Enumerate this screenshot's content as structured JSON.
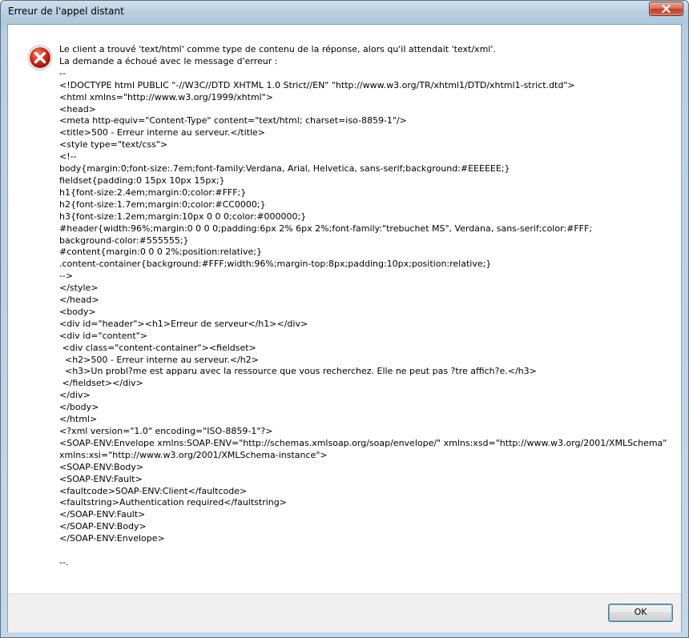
{
  "window": {
    "title": "Erreur de l'appel distant"
  },
  "icons": {
    "error": "error-icon",
    "close": "close-icon"
  },
  "message": {
    "text": "Le client a trouvé 'text/html' comme type de contenu de la réponse, alors qu'il attendait 'text/xml'.\nLa demande a échoué avec le message d'erreur :\n--\n<!DOCTYPE html PUBLIC \"-//W3C//DTD XHTML 1.0 Strict//EN\" \"http://www.w3.org/TR/xhtml1/DTD/xhtml1-strict.dtd\">\n<html xmlns=\"http://www.w3.org/1999/xhtml\">\n<head>\n<meta http-equiv=\"Content-Type\" content=\"text/html; charset=iso-8859-1\"/>\n<title>500 - Erreur interne au serveur.</title>\n<style type=\"text/css\">\n<!--\nbody{margin:0;font-size:.7em;font-family:Verdana, Arial, Helvetica, sans-serif;background:#EEEEEE;}\nfieldset{padding:0 15px 10px 15px;}\nh1{font-size:2.4em;margin:0;color:#FFF;}\nh2{font-size:1.7em;margin:0;color:#CC0000;}\nh3{font-size:1.2em;margin:10px 0 0 0;color:#000000;}\n#header{width:96%;margin:0 0 0 0;padding:6px 2% 6px 2%;font-family:\"trebuchet MS\", Verdana, sans-serif;color:#FFF;\nbackground-color:#555555;}\n#content{margin:0 0 0 2%;position:relative;}\n.content-container{background:#FFF;width:96%;margin-top:8px;padding:10px;position:relative;}\n-->\n</style>\n</head>\n<body>\n<div id=\"header\"><h1>Erreur de serveur</h1></div>\n<div id=\"content\">\n <div class=\"content-container\"><fieldset>\n  <h2>500 - Erreur interne au serveur.</h2>\n  <h3>Un probl?me est apparu avec la ressource que vous recherchez. Elle ne peut pas ?tre affich?e.</h3>\n </fieldset></div>\n</div>\n</body>\n</html>\n<?xml version=\"1.0\" encoding=\"ISO-8859-1\"?>\n<SOAP-ENV:Envelope xmlns:SOAP-ENV=\"http://schemas.xmlsoap.org/soap/envelope/\" xmlns:xsd=\"http://www.w3.org/2001/XMLSchema\"\nxmlns:xsi=\"http://www.w3.org/2001/XMLSchema-instance\">\n<SOAP-ENV:Body>\n<SOAP-ENV:Fault>\n<faultcode>SOAP-ENV:Client</faultcode>\n<faultstring>Authentication required</faultstring>\n</SOAP-ENV:Fault>\n</SOAP-ENV:Body>\n</SOAP-ENV:Envelope>\n\n--."
  },
  "buttons": {
    "ok_label": "OK"
  },
  "colors": {
    "error_red": "#d42a1c",
    "close_red": "#c23c22",
    "focus_blue": "#4fb6e8"
  }
}
